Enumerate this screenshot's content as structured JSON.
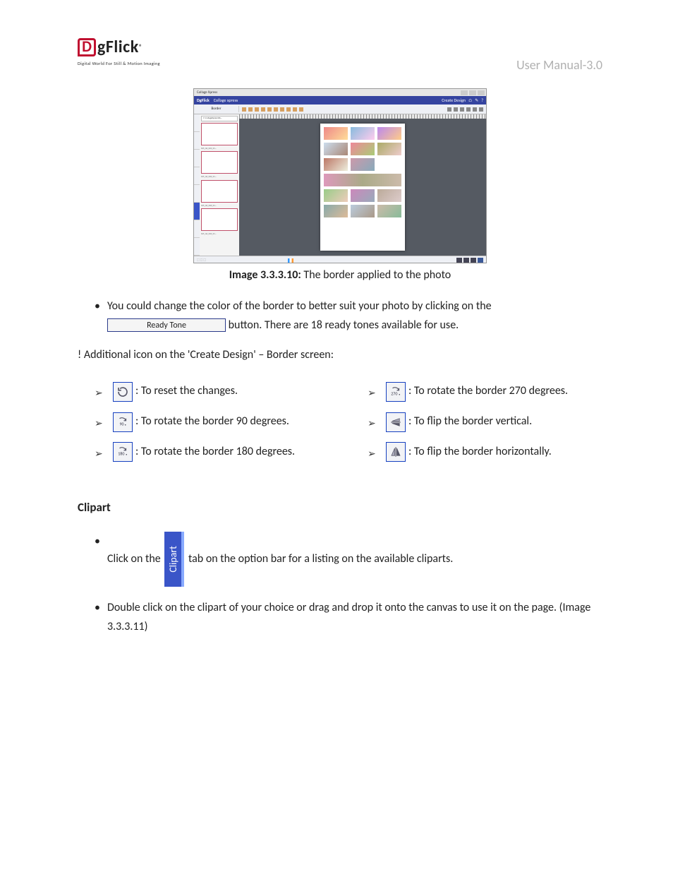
{
  "header": {
    "logo_letter": "D",
    "logo_text": "gFlick",
    "logo_r": "®",
    "logo_tagline": "Digital World For Still & Motion Imaging",
    "manual_title": "User Manual-3.0"
  },
  "screenshot": {
    "window_title": "Collage Xpress",
    "brand": "DgFlick",
    "breadcrumb": "Collage xpress",
    "create_design": "Create Design",
    "toolbar_label": "Border",
    "sidebar_path": "C:\\CollageXpress\\Bo...",
    "vtabs": [
      "Basic",
      "Adjust",
      "Photo",
      "Background",
      "Clipart",
      "Border",
      "Mask",
      "Title"
    ]
  },
  "caption_label": "Image 3.3.3.10:",
  "caption_text": " The border applied to the photo",
  "bullet1_a": "You could change the color of the border to better suit your photo by clicking on the ",
  "ready_tone_label": "Ready Tone",
  "bullet1_b": " button. There are 18 ready tones available for use.",
  "note": "! Additional icon on the 'Create Design' – Border screen:",
  "icons_left": [
    ": To reset the changes.",
    ": To rotate the border 90 degrees.",
    ": To rotate the border 180 degrees."
  ],
  "icon_90": "90",
  "icon_180": "180",
  "icon_270": "270",
  "icons_right": [
    ": To rotate the border 270 degrees.",
    ": To flip the border vertical.",
    ": To flip the border horizontally."
  ],
  "clipart_heading": "Clipart",
  "clipart_tab_label": "Clipart",
  "clipart_b1_a": "Click on the ",
  "clipart_b1_b": " tab on the option bar for a listing on the available cliparts.",
  "clipart_b2": "Double click on the clipart of your choice or drag and drop it onto the canvas to use it on the page. (Image 3.3.3.11)"
}
